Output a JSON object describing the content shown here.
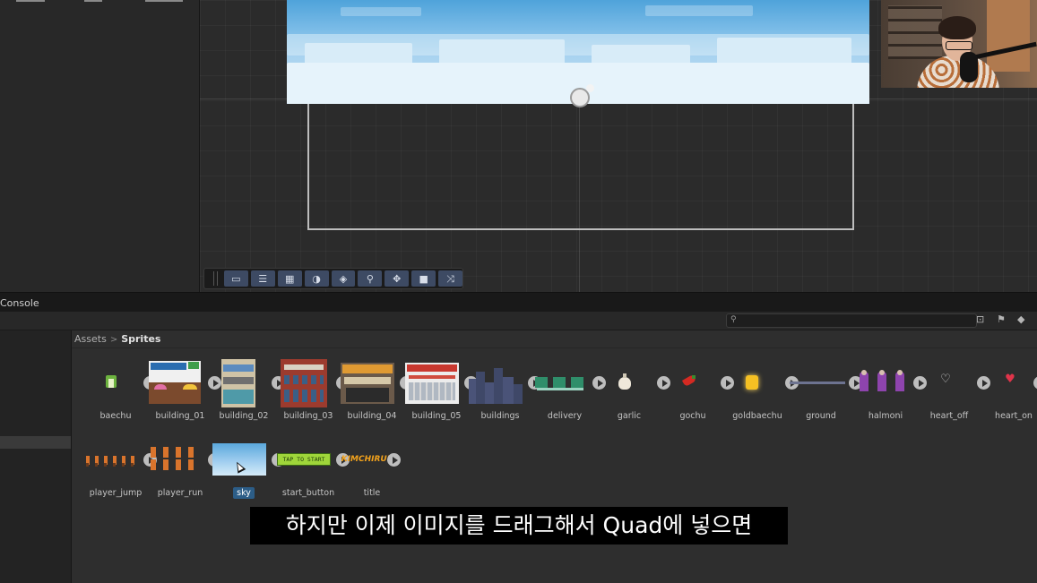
{
  "console": {
    "label": "Console"
  },
  "project": {
    "search": {
      "value": "",
      "placeholder": ""
    },
    "breadcrumb": {
      "root": "Assets",
      "current": "Sprites"
    },
    "assets": [
      {
        "name": "baechu",
        "icon": "cabbage-sprite"
      },
      {
        "name": "building_01",
        "icon": "building-sprite"
      },
      {
        "name": "building_02",
        "icon": "building-sprite"
      },
      {
        "name": "building_03",
        "icon": "building-sprite"
      },
      {
        "name": "building_04",
        "icon": "building-sprite"
      },
      {
        "name": "building_05",
        "icon": "building-sprite"
      },
      {
        "name": "buildings",
        "icon": "skyline-sprite"
      },
      {
        "name": "delivery",
        "icon": "delivery-sprite"
      },
      {
        "name": "garlic",
        "icon": "garlic-sprite"
      },
      {
        "name": "gochu",
        "icon": "pepper-sprite"
      },
      {
        "name": "goldbaechu",
        "icon": "gold-cabbage-sprite"
      },
      {
        "name": "ground",
        "icon": "ground-sprite"
      },
      {
        "name": "halmoni",
        "icon": "grandma-sprite"
      },
      {
        "name": "heart_off",
        "icon": "heart-outline-sprite"
      },
      {
        "name": "heart_on",
        "icon": "heart-filled-sprite"
      },
      {
        "name": "player_jump",
        "icon": "player-jump-sprite"
      },
      {
        "name": "player_run",
        "icon": "player-run-sprite"
      },
      {
        "name": "sky",
        "icon": "sky-sprite",
        "selected": true
      },
      {
        "name": "start_button",
        "icon": "start-button-sprite",
        "thumb_text": "TAP TO START"
      },
      {
        "name": "title",
        "icon": "title-sprite",
        "thumb_text": "KIMCHIRUN"
      }
    ]
  },
  "subtitle": "하지만 이제 이미지를 드래그해서 Quad에 넣으면",
  "colors": {
    "selection": "#2c5d87",
    "scene_bg": "#2b2b2b",
    "sky_top": "#4fa3da",
    "sky_bottom": "#c4e2f5"
  }
}
